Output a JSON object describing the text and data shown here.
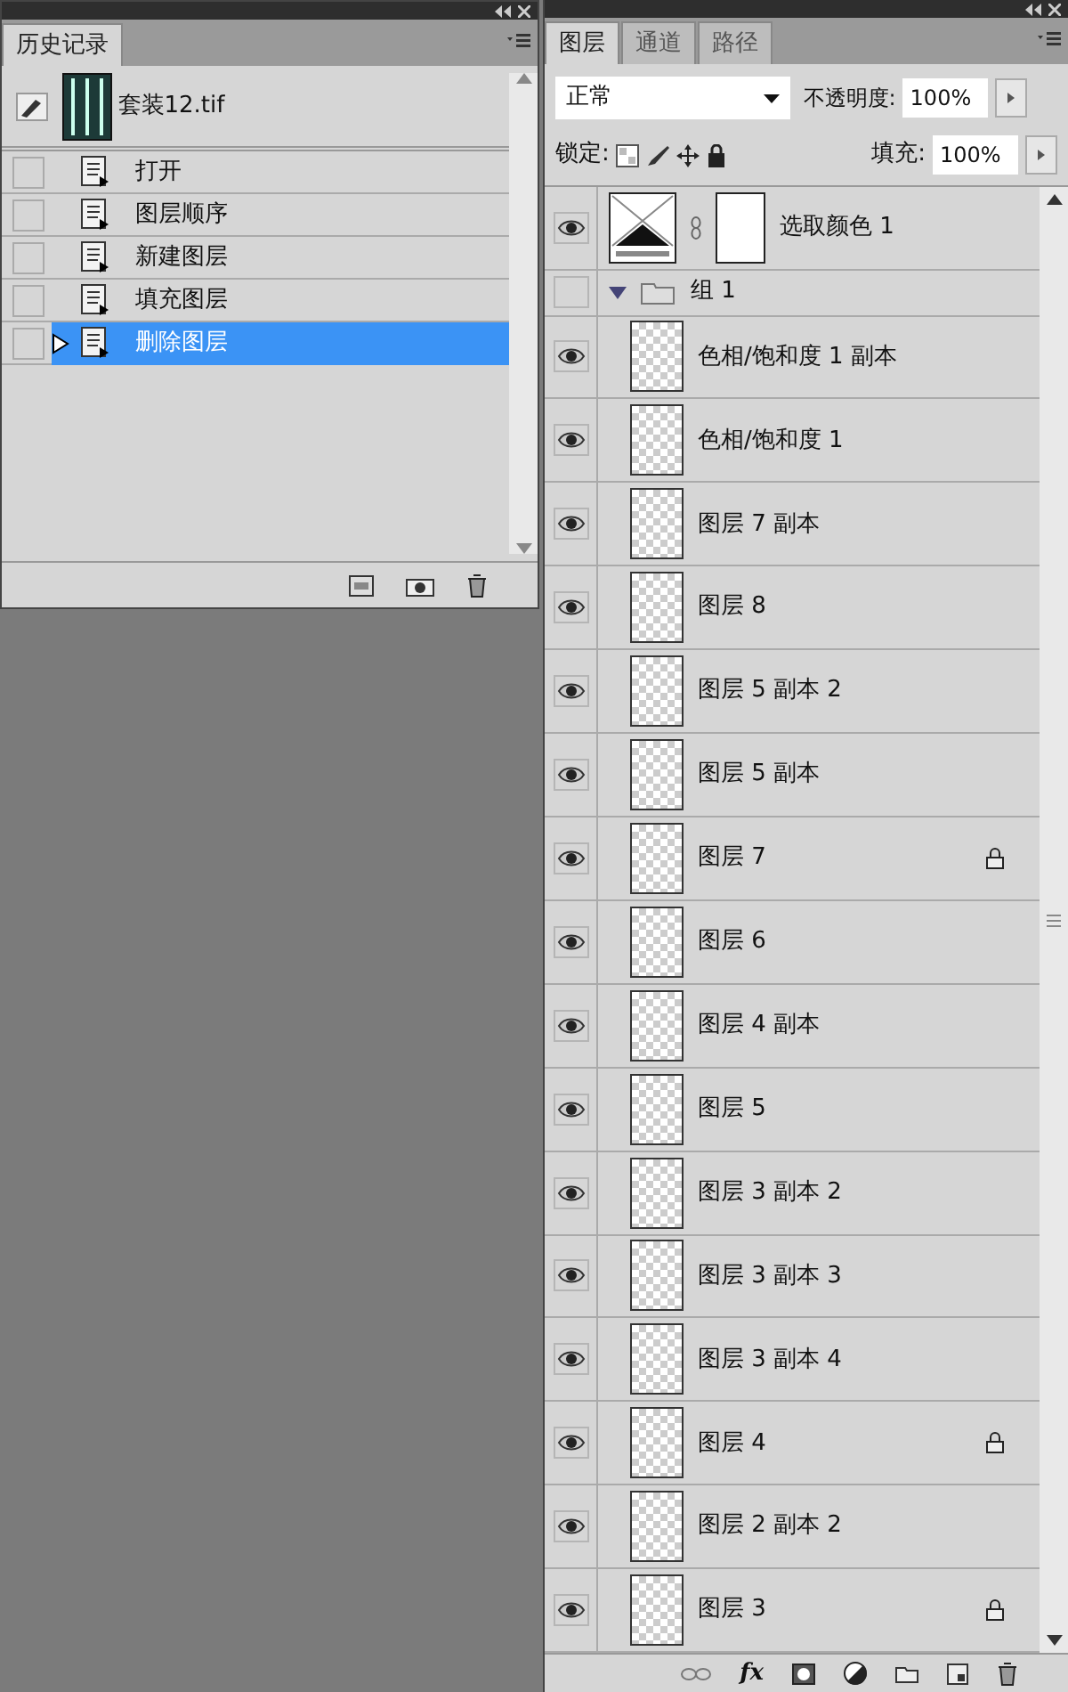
{
  "history_panel": {
    "tab": "历史记录",
    "snapshot": {
      "name": "套装12.tif"
    },
    "items": [
      {
        "label": "打开",
        "selected": false,
        "checked": false
      },
      {
        "label": "图层顺序",
        "selected": false,
        "checked": false
      },
      {
        "label": "新建图层",
        "selected": false,
        "checked": false
      },
      {
        "label": "填充图层",
        "selected": false,
        "checked": false
      },
      {
        "label": "删除图层",
        "selected": true,
        "checked": false
      }
    ]
  },
  "layers_panel": {
    "tabs": [
      {
        "label": "图层",
        "selected": true
      },
      {
        "label": "通道",
        "selected": false
      },
      {
        "label": "路径",
        "selected": false
      }
    ],
    "blend_mode": "正常",
    "opacity_label": "不透明度:",
    "opacity": "100%",
    "lock_label": "锁定:",
    "fill_label": "填充:",
    "fill": "100%",
    "layers": [
      {
        "kind": "adjustment",
        "name": "选取颜色 1",
        "visible": true,
        "locked": false
      },
      {
        "kind": "group",
        "name": "组 1",
        "visible": false,
        "expanded": true,
        "children": [
          {
            "kind": "pixel",
            "name": "色相/饱和度 1 副本",
            "visible": true,
            "locked": false
          },
          {
            "kind": "pixel",
            "name": "色相/饱和度 1",
            "visible": true,
            "locked": false
          },
          {
            "kind": "pixel",
            "name": "图层 7 副本",
            "visible": true,
            "locked": false
          },
          {
            "kind": "pixel",
            "name": "图层 8",
            "visible": true,
            "locked": false
          },
          {
            "kind": "pixel",
            "name": "图层 5 副本 2",
            "visible": true,
            "locked": false
          },
          {
            "kind": "pixel",
            "name": "图层 5 副本",
            "visible": true,
            "locked": false
          },
          {
            "kind": "pixel",
            "name": "图层 7",
            "visible": true,
            "locked": true
          },
          {
            "kind": "pixel",
            "name": "图层 6",
            "visible": true,
            "locked": false
          },
          {
            "kind": "pixel",
            "name": "图层 4 副本",
            "visible": true,
            "locked": false
          },
          {
            "kind": "pixel",
            "name": "图层 5",
            "visible": true,
            "locked": false
          },
          {
            "kind": "pixel",
            "name": "图层 3 副本 2",
            "visible": true,
            "locked": false
          },
          {
            "kind": "pixel",
            "name": "图层 3 副本 3",
            "visible": true,
            "locked": false
          },
          {
            "kind": "pixel",
            "name": "图层 3 副本 4",
            "visible": true,
            "locked": false
          },
          {
            "kind": "pixel",
            "name": "图层 4",
            "visible": true,
            "locked": true
          },
          {
            "kind": "pixel",
            "name": "图层 2 副本 2",
            "visible": true,
            "locked": false
          },
          {
            "kind": "pixel",
            "name": "图层 3",
            "visible": true,
            "locked": true
          }
        ]
      }
    ],
    "fx_label": "fx"
  }
}
